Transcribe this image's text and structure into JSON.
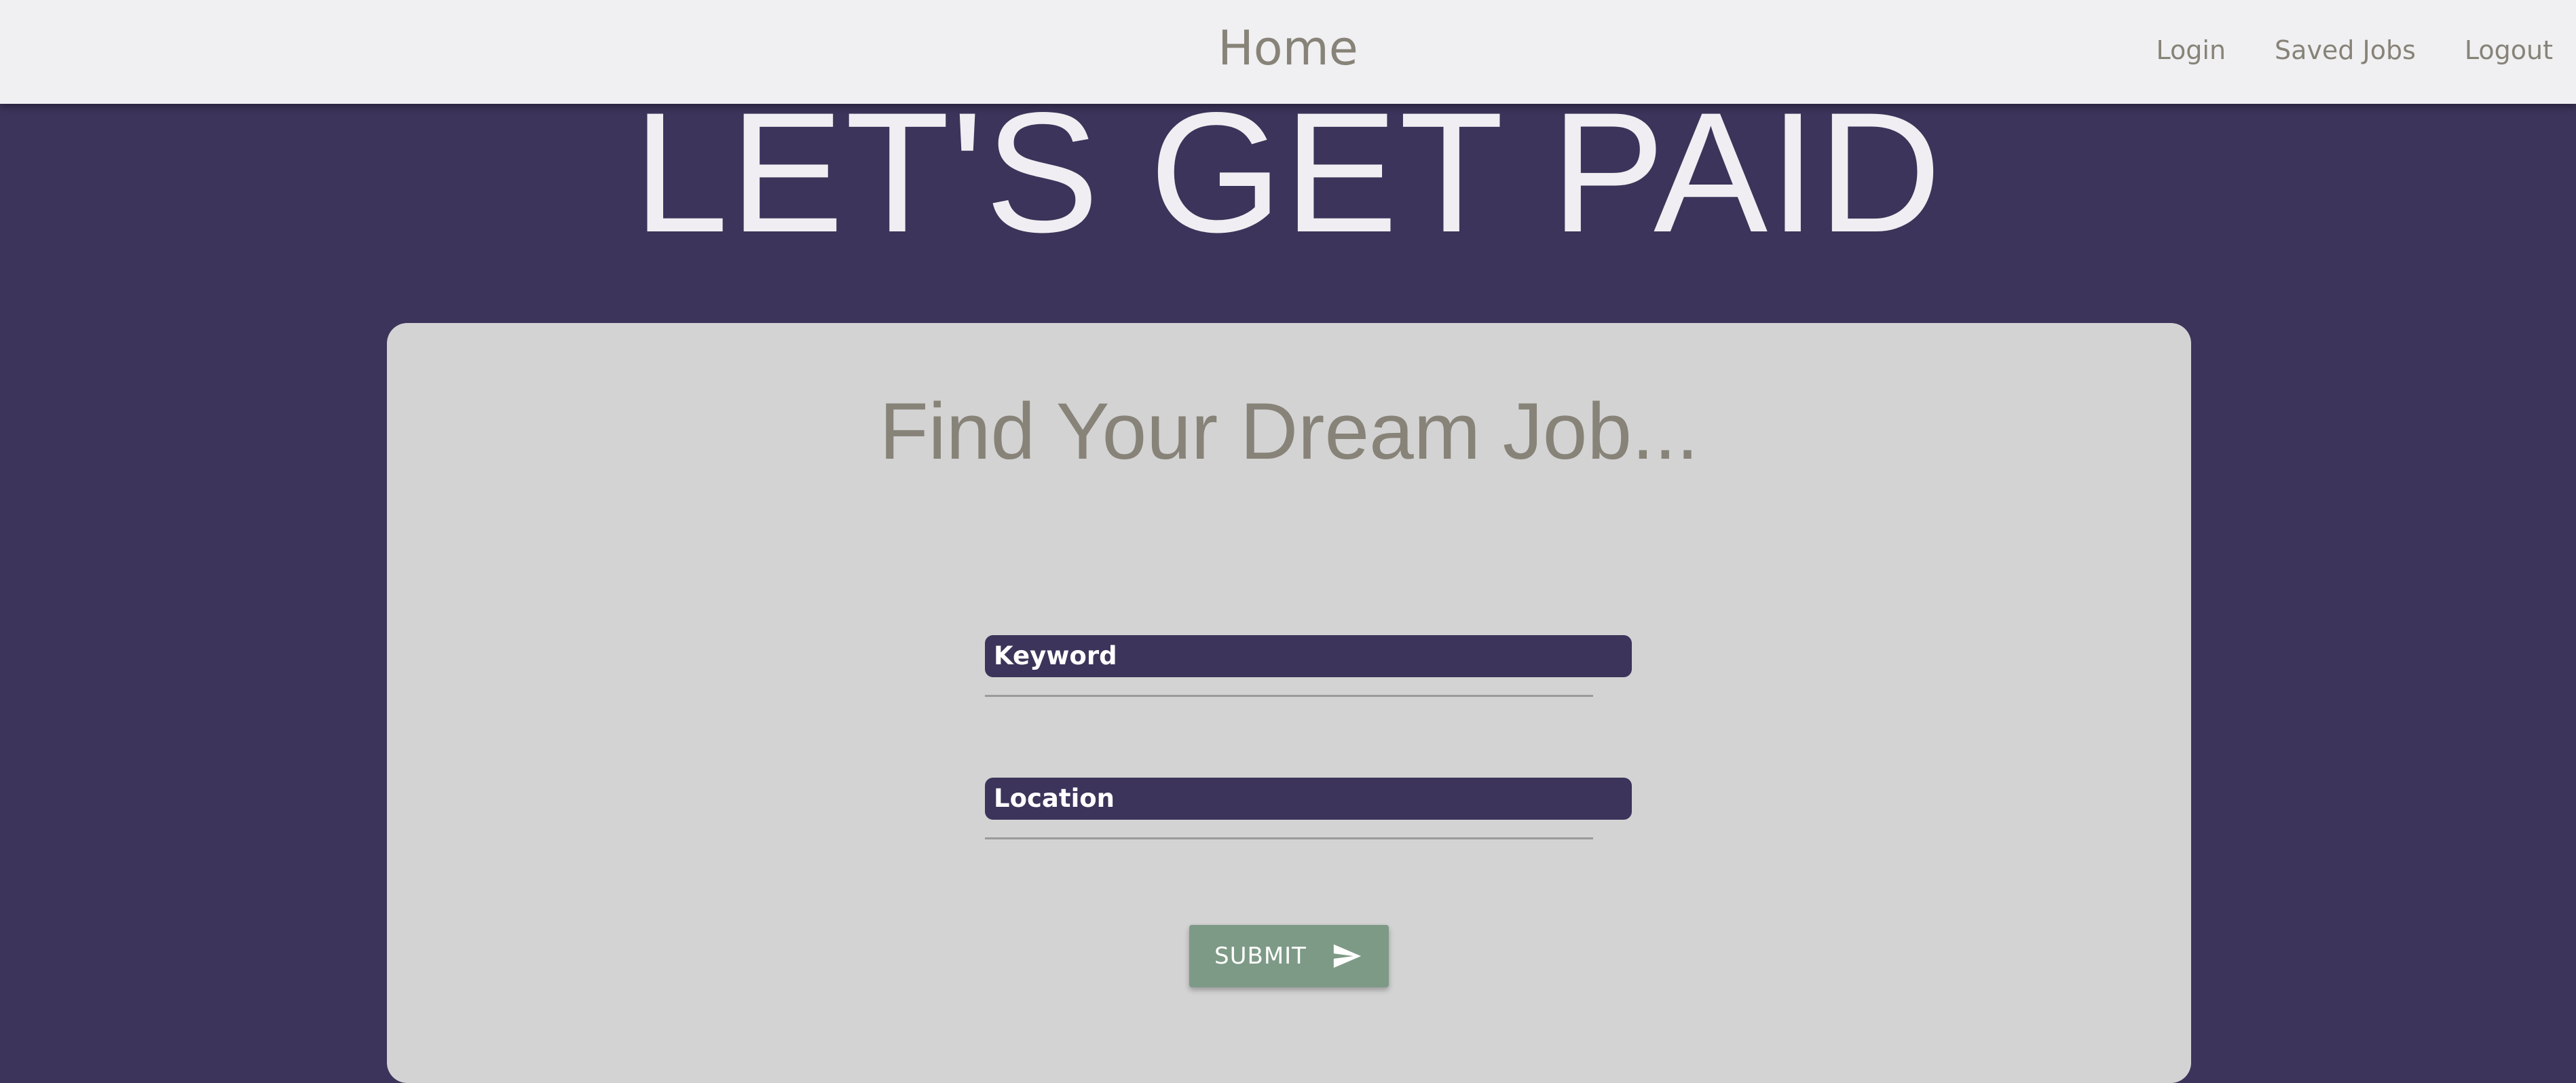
{
  "nav": {
    "brand": "Home",
    "links": [
      "Login",
      "Saved Jobs",
      "Logout"
    ]
  },
  "hero": {
    "title": "LET'S GET PAID"
  },
  "search_card": {
    "title": "Find Your Dream Job...",
    "keyword_label": "Keyword",
    "keyword_value": "",
    "location_label": "Location",
    "location_value": "",
    "submit_label": "SUBMIT",
    "submit_icon": "send-icon"
  },
  "colors": {
    "background": "#3c345a",
    "navbar": "#f0f0f2",
    "nav_text": "#878378",
    "card": "#d3d3d3",
    "label_bg": "#3c345a",
    "submit": "#7d9a86"
  }
}
